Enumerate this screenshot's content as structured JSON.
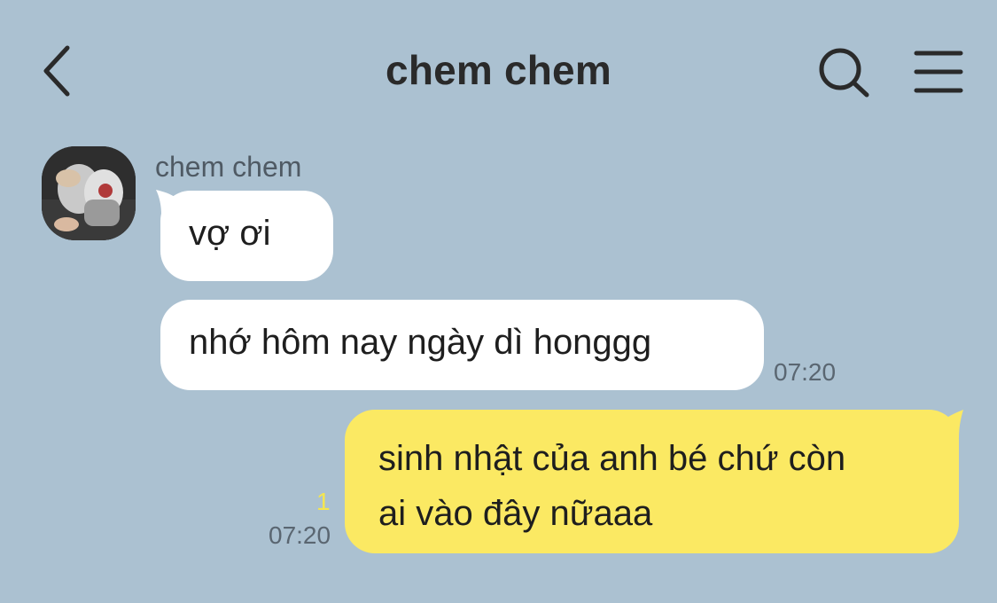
{
  "header": {
    "title": "chem chem",
    "back_icon": "chevron-left-icon",
    "search_icon": "search-icon",
    "menu_icon": "menu-icon"
  },
  "conversation": {
    "sender_name": "chem chem",
    "incoming": [
      {
        "text": "vợ ơi",
        "time": ""
      },
      {
        "text": "nhớ hôm nay ngày dì honggg",
        "time": "07:20"
      }
    ],
    "outgoing": [
      {
        "lines": [
          "sinh nhật của anh bé chứ còn",
          "ai vào đây nữaaa"
        ],
        "time": "07:20",
        "unread_count": "1"
      }
    ]
  },
  "colors": {
    "background": "#abc1d1",
    "incoming_bubble": "#ffffff",
    "outgoing_bubble": "#fbe963",
    "unread_count": "#f4e64f",
    "timestamp": "#5a6671"
  }
}
